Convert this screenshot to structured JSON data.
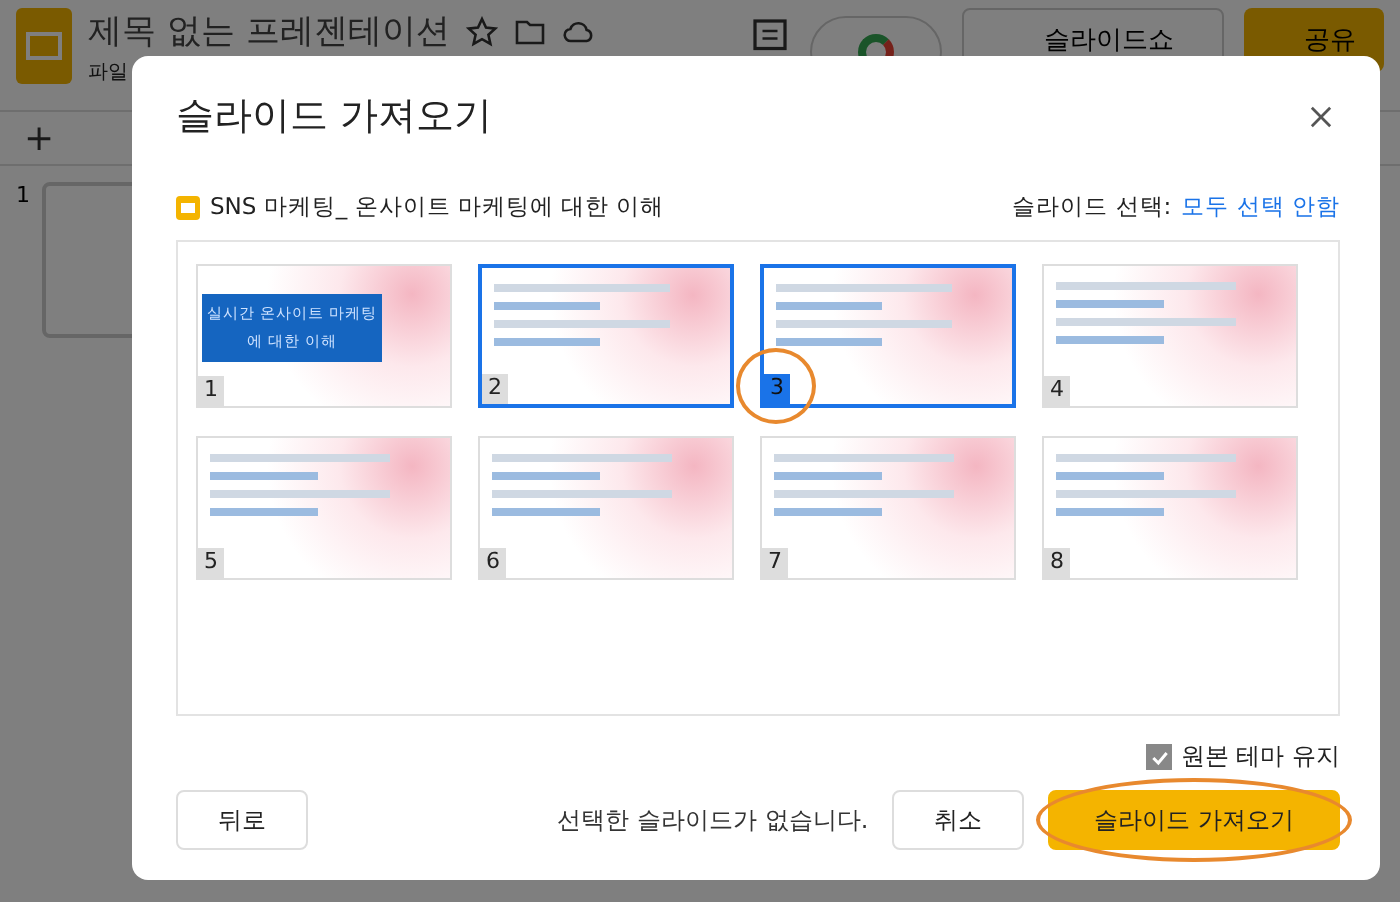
{
  "app": {
    "doc_title": "제목 없는 프레젠테이션",
    "menu": [
      "파일"
    ],
    "slideshow_button": "슬라이드쇼",
    "share_button": "공유",
    "add_button": "+",
    "filmstrip": [
      "1"
    ]
  },
  "dialog": {
    "title": "슬라이드 가져오기",
    "source": "SNS 마케팅_ 온사이트 마케팅에 대한 이해",
    "select_label": "슬라이드 선택:",
    "select_none_link": "모두 선택 안함",
    "slides": [
      {
        "number": "1",
        "title": "실시간 온사이트 마케팅에 대한 이해",
        "selected": false,
        "hovered": false,
        "circled": false
      },
      {
        "number": "2",
        "selected": false,
        "hovered": true,
        "circled": false
      },
      {
        "number": "3",
        "selected": true,
        "hovered": false,
        "circled": true
      },
      {
        "number": "4",
        "selected": false,
        "hovered": false,
        "circled": false
      },
      {
        "number": "5",
        "selected": false,
        "hovered": false,
        "circled": false
      },
      {
        "number": "6",
        "selected": false,
        "hovered": false,
        "circled": false
      },
      {
        "number": "7",
        "selected": false,
        "hovered": false,
        "circled": false
      },
      {
        "number": "8",
        "selected": false,
        "hovered": false,
        "circled": false
      }
    ],
    "keep_theme": {
      "label": "원본 테마 유지",
      "checked": true
    },
    "back_button": "뒤로",
    "status": "선택한 슬라이드가 없습니다.",
    "cancel_button": "취소",
    "import_button": {
      "label": "슬라이드 가져오기",
      "circled": true
    }
  }
}
